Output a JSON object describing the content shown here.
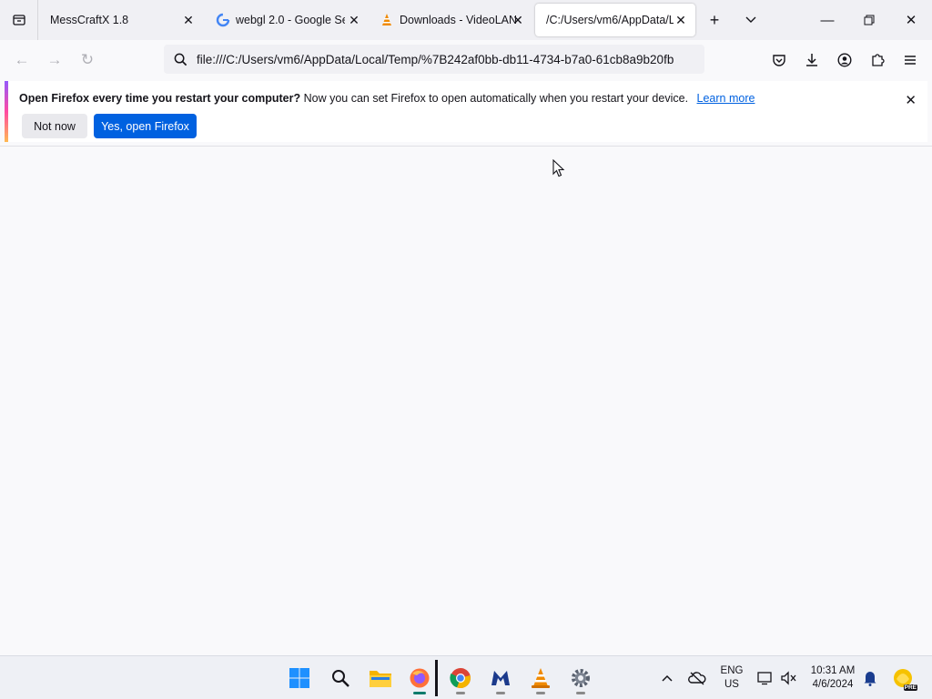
{
  "tabs": [
    {
      "title": "MessCraftX 1.8",
      "icon": "none"
    },
    {
      "title": "webgl 2.0 - Google Sea",
      "icon": "google-icon"
    },
    {
      "title": "Downloads - VideoLAN",
      "icon": "vlc-icon"
    },
    {
      "title": "/C:/Users/vm6/AppData/Lo",
      "icon": "none",
      "active": true
    }
  ],
  "address": {
    "url": "file:///C:/Users/vm6/AppData/Local/Temp/%7B242af0bb-db11-4734-b7a0-61cb8a9b20fb"
  },
  "notification": {
    "title": "Open Firefox every time you restart your computer?",
    "body": "Now you can set Firefox to open automatically when you restart your device.",
    "link": "Learn more",
    "secondary_button": "Not now",
    "primary_button": "Yes, open Firefox"
  },
  "taskbar": {
    "apps": [
      "start-icon",
      "search-icon",
      "file-explorer-icon",
      "firefox-icon",
      "chrome-icon",
      "malwarebytes-icon",
      "vlc-icon",
      "settings-icon"
    ],
    "lang_line1": "ENG",
    "lang_line2": "US",
    "time": "10:31 AM",
    "date": "4/6/2024",
    "badge": "PRE"
  },
  "colors": {
    "accent": "#0061e0",
    "tabstrip": "#f0f0f4",
    "taskbar": "#eef0f5"
  }
}
